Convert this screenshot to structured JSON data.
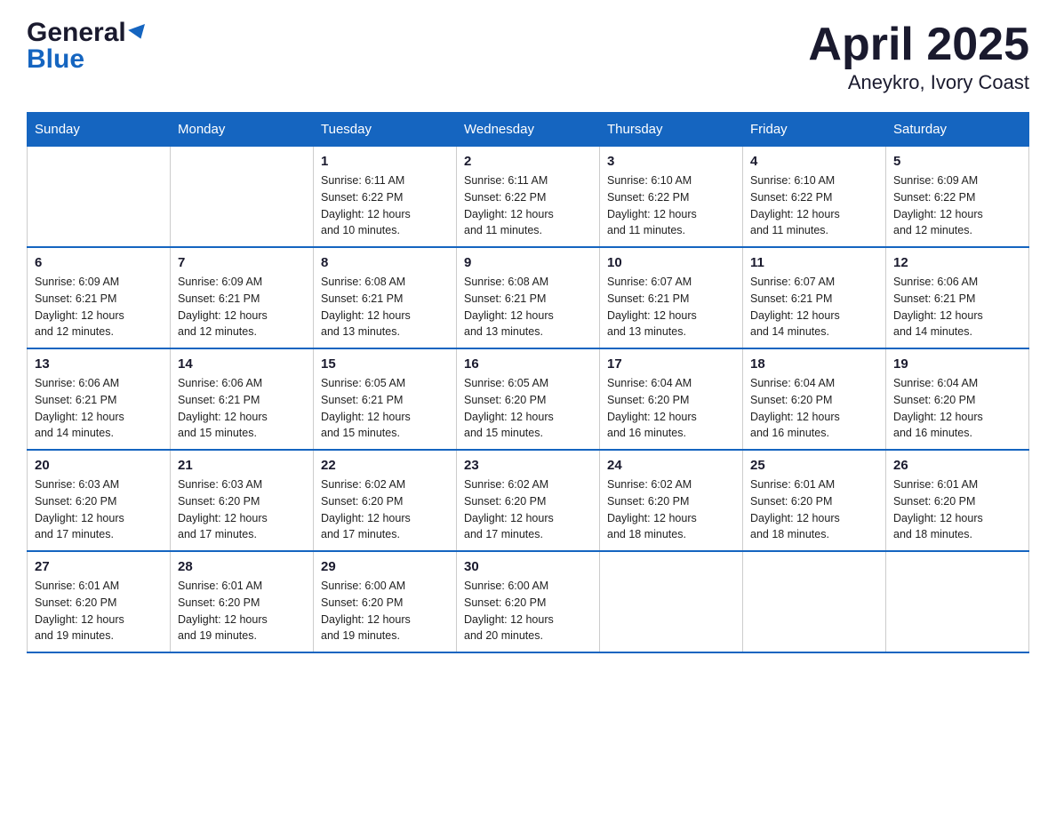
{
  "logo": {
    "general": "General",
    "blue": "Blue"
  },
  "title": "April 2025",
  "subtitle": "Aneykro, Ivory Coast",
  "weekdays": [
    "Sunday",
    "Monday",
    "Tuesday",
    "Wednesday",
    "Thursday",
    "Friday",
    "Saturday"
  ],
  "weeks": [
    [
      {
        "day": "",
        "info": ""
      },
      {
        "day": "",
        "info": ""
      },
      {
        "day": "1",
        "info": "Sunrise: 6:11 AM\nSunset: 6:22 PM\nDaylight: 12 hours\nand 10 minutes."
      },
      {
        "day": "2",
        "info": "Sunrise: 6:11 AM\nSunset: 6:22 PM\nDaylight: 12 hours\nand 11 minutes."
      },
      {
        "day": "3",
        "info": "Sunrise: 6:10 AM\nSunset: 6:22 PM\nDaylight: 12 hours\nand 11 minutes."
      },
      {
        "day": "4",
        "info": "Sunrise: 6:10 AM\nSunset: 6:22 PM\nDaylight: 12 hours\nand 11 minutes."
      },
      {
        "day": "5",
        "info": "Sunrise: 6:09 AM\nSunset: 6:22 PM\nDaylight: 12 hours\nand 12 minutes."
      }
    ],
    [
      {
        "day": "6",
        "info": "Sunrise: 6:09 AM\nSunset: 6:21 PM\nDaylight: 12 hours\nand 12 minutes."
      },
      {
        "day": "7",
        "info": "Sunrise: 6:09 AM\nSunset: 6:21 PM\nDaylight: 12 hours\nand 12 minutes."
      },
      {
        "day": "8",
        "info": "Sunrise: 6:08 AM\nSunset: 6:21 PM\nDaylight: 12 hours\nand 13 minutes."
      },
      {
        "day": "9",
        "info": "Sunrise: 6:08 AM\nSunset: 6:21 PM\nDaylight: 12 hours\nand 13 minutes."
      },
      {
        "day": "10",
        "info": "Sunrise: 6:07 AM\nSunset: 6:21 PM\nDaylight: 12 hours\nand 13 minutes."
      },
      {
        "day": "11",
        "info": "Sunrise: 6:07 AM\nSunset: 6:21 PM\nDaylight: 12 hours\nand 14 minutes."
      },
      {
        "day": "12",
        "info": "Sunrise: 6:06 AM\nSunset: 6:21 PM\nDaylight: 12 hours\nand 14 minutes."
      }
    ],
    [
      {
        "day": "13",
        "info": "Sunrise: 6:06 AM\nSunset: 6:21 PM\nDaylight: 12 hours\nand 14 minutes."
      },
      {
        "day": "14",
        "info": "Sunrise: 6:06 AM\nSunset: 6:21 PM\nDaylight: 12 hours\nand 15 minutes."
      },
      {
        "day": "15",
        "info": "Sunrise: 6:05 AM\nSunset: 6:21 PM\nDaylight: 12 hours\nand 15 minutes."
      },
      {
        "day": "16",
        "info": "Sunrise: 6:05 AM\nSunset: 6:20 PM\nDaylight: 12 hours\nand 15 minutes."
      },
      {
        "day": "17",
        "info": "Sunrise: 6:04 AM\nSunset: 6:20 PM\nDaylight: 12 hours\nand 16 minutes."
      },
      {
        "day": "18",
        "info": "Sunrise: 6:04 AM\nSunset: 6:20 PM\nDaylight: 12 hours\nand 16 minutes."
      },
      {
        "day": "19",
        "info": "Sunrise: 6:04 AM\nSunset: 6:20 PM\nDaylight: 12 hours\nand 16 minutes."
      }
    ],
    [
      {
        "day": "20",
        "info": "Sunrise: 6:03 AM\nSunset: 6:20 PM\nDaylight: 12 hours\nand 17 minutes."
      },
      {
        "day": "21",
        "info": "Sunrise: 6:03 AM\nSunset: 6:20 PM\nDaylight: 12 hours\nand 17 minutes."
      },
      {
        "day": "22",
        "info": "Sunrise: 6:02 AM\nSunset: 6:20 PM\nDaylight: 12 hours\nand 17 minutes."
      },
      {
        "day": "23",
        "info": "Sunrise: 6:02 AM\nSunset: 6:20 PM\nDaylight: 12 hours\nand 17 minutes."
      },
      {
        "day": "24",
        "info": "Sunrise: 6:02 AM\nSunset: 6:20 PM\nDaylight: 12 hours\nand 18 minutes."
      },
      {
        "day": "25",
        "info": "Sunrise: 6:01 AM\nSunset: 6:20 PM\nDaylight: 12 hours\nand 18 minutes."
      },
      {
        "day": "26",
        "info": "Sunrise: 6:01 AM\nSunset: 6:20 PM\nDaylight: 12 hours\nand 18 minutes."
      }
    ],
    [
      {
        "day": "27",
        "info": "Sunrise: 6:01 AM\nSunset: 6:20 PM\nDaylight: 12 hours\nand 19 minutes."
      },
      {
        "day": "28",
        "info": "Sunrise: 6:01 AM\nSunset: 6:20 PM\nDaylight: 12 hours\nand 19 minutes."
      },
      {
        "day": "29",
        "info": "Sunrise: 6:00 AM\nSunset: 6:20 PM\nDaylight: 12 hours\nand 19 minutes."
      },
      {
        "day": "30",
        "info": "Sunrise: 6:00 AM\nSunset: 6:20 PM\nDaylight: 12 hours\nand 20 minutes."
      },
      {
        "day": "",
        "info": ""
      },
      {
        "day": "",
        "info": ""
      },
      {
        "day": "",
        "info": ""
      }
    ]
  ]
}
